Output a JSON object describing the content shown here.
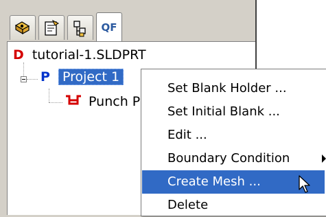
{
  "tabs": [
    {
      "icon": "feature-manager-icon"
    },
    {
      "icon": "property-manager-icon"
    },
    {
      "icon": "configuration-manager-icon"
    },
    {
      "label": "QF",
      "active": true
    }
  ],
  "tree": {
    "root": {
      "letter": "D",
      "label": "tutorial-1.SLDPRT"
    },
    "project": {
      "letter": "P",
      "label": "Project 1"
    },
    "punch": {
      "label": "Punch P"
    }
  },
  "context_menu": {
    "items": [
      {
        "label": "Set Blank Holder ..."
      },
      {
        "label": "Set Initial Blank ..."
      },
      {
        "label": "Edit ..."
      },
      {
        "label": "Boundary Condition",
        "submenu": true
      },
      {
        "label": "Create Mesh ...",
        "highlighted": true
      },
      {
        "label": "Delete"
      }
    ]
  },
  "colors": {
    "selection": "#316ac5",
    "root_letter": "#d40000",
    "project_letter": "#0033cc",
    "punch_icon": "#d40000"
  }
}
